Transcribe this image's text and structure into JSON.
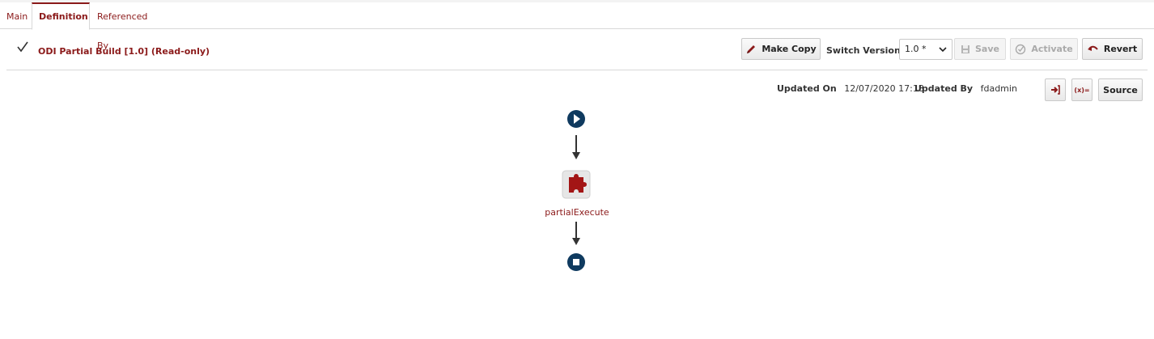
{
  "tabs": [
    {
      "label": "Main",
      "active": false
    },
    {
      "label": "Definition",
      "active": true
    },
    {
      "label": "Referenced By",
      "active": false
    }
  ],
  "header": {
    "title": "ODI Partial Build [1.0] (Read-only)",
    "make_copy_label": "Make Copy",
    "switch_version_label": "Switch Version",
    "version_value": "1.0 *",
    "save_label": "Save",
    "activate_label": "Activate",
    "revert_label": "Revert"
  },
  "meta": {
    "updated_on_label": "Updated On",
    "updated_on_value": "12/07/2020 17:18",
    "updated_by_label": "Updated By",
    "updated_by_value": "fdadmin",
    "variables_icon_text": "(x)=",
    "source_label": "Source"
  },
  "flow": {
    "step_label": "partialExecute"
  },
  "colors": {
    "accent": "#8b1a1a",
    "node_blue": "#0f3a5f"
  }
}
